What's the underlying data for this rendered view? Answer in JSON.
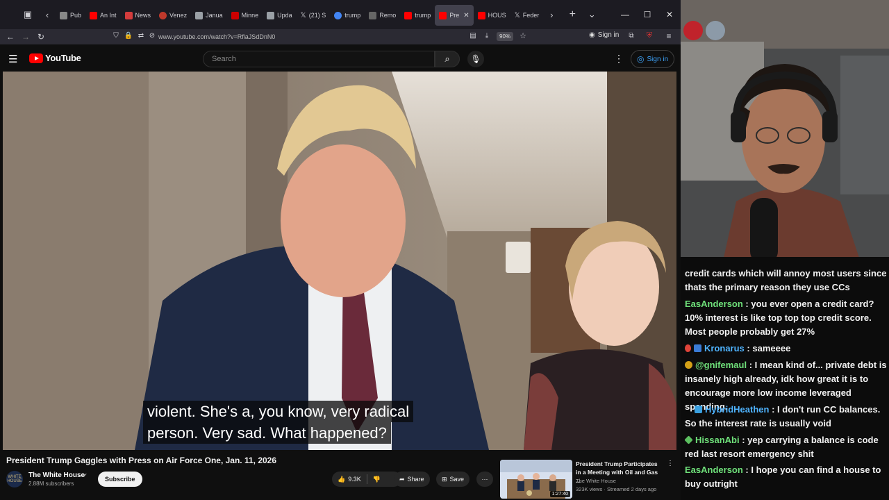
{
  "browser": {
    "tabs": [
      {
        "label": "Pub",
        "color": "#888888"
      },
      {
        "label": "An Int",
        "color": "#ff0000"
      },
      {
        "label": "News",
        "color": "#d33c3c"
      },
      {
        "label": "Venez",
        "color": "#c0392b"
      },
      {
        "label": "Janua",
        "color": "#9aa0a6"
      },
      {
        "label": "Minne",
        "color": "#cc0000"
      },
      {
        "label": "Upda",
        "color": "#9aa0a6"
      },
      {
        "label": "(21) S",
        "color": "#ffffff"
      },
      {
        "label": "trump",
        "color": "#4285f4"
      },
      {
        "label": "Remo",
        "color": "#666666"
      },
      {
        "label": "trump",
        "color": "#ff0000"
      },
      {
        "label": "Pre",
        "color": "#ff0000"
      },
      {
        "label": "HOUS",
        "color": "#ff0000"
      },
      {
        "label": "Feder",
        "color": "#ffffff"
      }
    ],
    "url": "www.youtube.com/watch?v=RflaJSdDnN0",
    "zoom": "90%",
    "signin_label": "Sign in"
  },
  "youtube": {
    "logo_text": "YouTube",
    "search_placeholder": "Search",
    "signin_label": "Sign in"
  },
  "video": {
    "caption_line1": "violent. She's a, you know, very radical",
    "caption_line2": "person. Very sad. What happened?",
    "title": "President Trump Gaggles with Press on Air Force One, Jan. 11, 2026",
    "channel": "The White House",
    "channel_avatar_text": "WHITE HOUSE",
    "subscribers": "2.88M subscribers",
    "subscribe_label": "Subscribe",
    "likes": "9.3K",
    "share_label": "Share",
    "save_label": "Save"
  },
  "recommendation": {
    "title": "President Trump Participates in a Meeting with Oil and Gas ...",
    "channel": "The White House",
    "meta": "323K views · Streamed 2 days ago",
    "duration": "1:27:40"
  },
  "chat": {
    "messages": [
      {
        "user": "",
        "text": "credit cards which will annoy most users since thats the primary reason they use CCs",
        "badge_color": ""
      },
      {
        "user": "EasAnderson",
        "text": "you ever open a credit card? 10% interest is like top top top credit score. Most people probably get 27%",
        "badge_color": ""
      },
      {
        "user": "Kronarus",
        "text": "sameeee",
        "badge_color": "#3a7bd5"
      },
      {
        "user": "@gnifemaul",
        "text": "I mean kind of... private debt is insanely high already, idk how great it is to encourage more low income leveraged spending.",
        "badge_color": "#d4a017"
      },
      {
        "user": "HybridHeathen",
        "text": "I don't run CC balances. So the interest rate is usually void",
        "badge_color": "#3aa0e0"
      },
      {
        "user": "HissanAbi",
        "text": "yep carrying a balance is code red last resort emergency shit",
        "badge_color": "#5cc060"
      },
      {
        "user": "EasAnderson",
        "text": "I hope you can find a house to buy outright",
        "badge_color": ""
      }
    ]
  }
}
